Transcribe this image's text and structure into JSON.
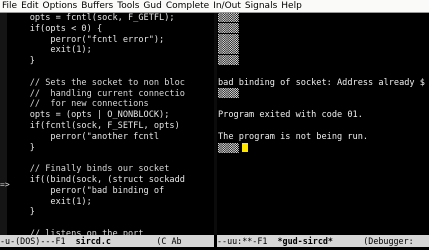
{
  "menubar": {
    "items": [
      "File",
      "Edit",
      "Options",
      "Buffers",
      "Tools",
      "Gud",
      "Complete",
      "In/Out",
      "Signals",
      "Help"
    ]
  },
  "left_pane": {
    "lines": [
      {
        "text": "    opts = fcntl(sock, F_GETFL);",
        "style": "code"
      },
      {
        "text": "    if(opts < 0) {",
        "style": "code"
      },
      {
        "text": "        perror(\"fcntl error\");",
        "style": "code"
      },
      {
        "text": "        exit(1);",
        "style": "code"
      },
      {
        "text": "    }",
        "style": "code"
      },
      {
        "text": "",
        "style": "code"
      },
      {
        "text": "    // Sets the socket to non bloc",
        "style": "comment"
      },
      {
        "text": "    //  handling current connectio",
        "style": "comment"
      },
      {
        "text": "    //  for new connections",
        "style": "comment"
      },
      {
        "text": "    opts = (opts | O_NONBLOCK);",
        "style": "code"
      },
      {
        "text": "    if(fcntl(sock, F_SETFL, opts) ",
        "style": "code"
      },
      {
        "text": "        perror(\"another fcntl ",
        "style": "code"
      },
      {
        "text": "    }",
        "style": "code"
      },
      {
        "text": "",
        "style": "code"
      },
      {
        "text": "    // Finally binds our socket",
        "style": "comment"
      },
      {
        "text": "    if((bind(sock, (struct sockadd",
        "style": "code"
      },
      {
        "text": "        perror(\"bad binding of",
        "style": "code"
      },
      {
        "text": "        exit(1);",
        "style": "code"
      },
      {
        "text": "    }",
        "style": "code"
      },
      {
        "text": "",
        "style": "code"
      },
      {
        "text": "    // listens on the port",
        "style": "comment"
      }
    ],
    "pointer": "=>"
  },
  "right_pane": {
    "lines": [
      {
        "text": "▒▒▒▒",
        "style": "blue"
      },
      {
        "text": "▒▒▒▒",
        "style": "blue"
      },
      {
        "text": "▒▒▒▒",
        "style": "blue"
      },
      {
        "text": "▒▒▒▒",
        "style": "blue"
      },
      {
        "text": "▒▒▒▒",
        "style": "blue"
      },
      {
        "text": "",
        "style": "code"
      },
      {
        "text": "bad binding of socket: Address already $",
        "style": "code"
      },
      {
        "text": "▒▒▒▒",
        "style": "blue"
      },
      {
        "text": "",
        "style": "code"
      },
      {
        "text": "Program exited with code 01.",
        "style": "code"
      },
      {
        "text": "",
        "style": "code"
      },
      {
        "text": "The program is not being run.",
        "style": "code"
      },
      {
        "text": "▒▒▒▒",
        "style": "blue",
        "cursor": true
      }
    ]
  },
  "modeline_left": {
    "prefix": "-u-(DOS)---F1  ",
    "buffer": "sircd.c",
    "suffix": "         (C Ab"
  },
  "modeline_right": {
    "prefix": "--uu:**-F1  ",
    "buffer": "*gud-sircd*",
    "suffix": "      (Debugger:"
  },
  "colors": {
    "background": "#000000",
    "menubar": "#fafaf8",
    "modeline": "#d6d6d6",
    "cursor": "#ffe600",
    "prompt_blue": "#4a3cff"
  }
}
